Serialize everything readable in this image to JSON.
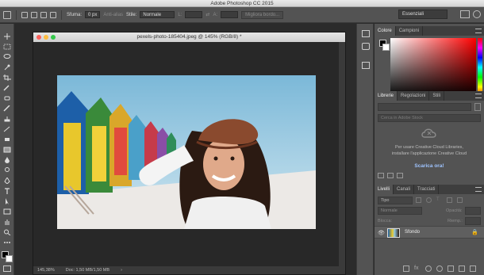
{
  "app": {
    "title": "Adobe Photoshop CC 2015"
  },
  "options_bar": {
    "feather_label": "Sfuma:",
    "feather_value": "0 px",
    "antialias_label": "Anti-alias",
    "style_label": "Stile:",
    "style_value": "Normale",
    "width_label": "L:",
    "height_label": "A:",
    "refine_edge_label": "Migliora bordo...",
    "workspace_value": "Essenziali"
  },
  "document": {
    "title": "pexels-photo-185404.jpeg @ 145% (RGB/8) *",
    "zoom": "145,38%",
    "doc_info": "Doc: 1,50 MB/1,50 MB"
  },
  "panels": {
    "color": {
      "tabs": [
        "Colore",
        "Campioni"
      ],
      "active": 0
    },
    "libraries": {
      "tabs": [
        "Librerie",
        "Regolazioni",
        "Stili"
      ],
      "active": 0,
      "search_placeholder": "Cerca in Adobe Stock",
      "message_line1": "Per usare Creative Cloud Libraries,",
      "message_line2": "installare l'applicazione Creative Cloud",
      "download_link": "Scarica ora!"
    },
    "layers": {
      "tabs": [
        "Livelli",
        "Canali",
        "Tracciati"
      ],
      "active": 0,
      "filter_label": "Tipo",
      "blend_mode": "Normale",
      "opacity_label": "Opacità:",
      "lock_label": "Blocca:",
      "fill_label": "Riemp.:",
      "layer_name": "Sfondo"
    }
  },
  "colors": {
    "accent_link": "#9fc4ff",
    "panel_bg": "#535353"
  }
}
